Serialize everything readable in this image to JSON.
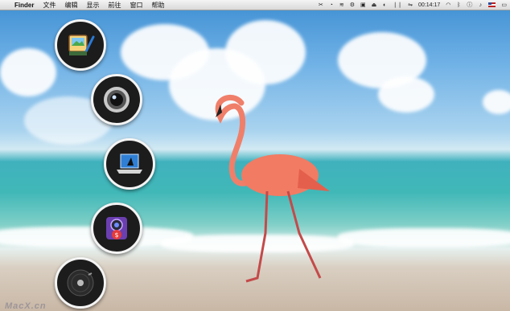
{
  "menubar": {
    "app_name": "Finder",
    "menus": [
      "文件",
      "编辑",
      "显示",
      "前往",
      "窗口",
      "帮助"
    ],
    "status": {
      "clock": "00:14:17",
      "clock_icon": "sync-arrows-icon"
    }
  },
  "dock": {
    "items": [
      {
        "name": "photo-editor-app-icon"
      },
      {
        "name": "camera-lens-app-icon"
      },
      {
        "name": "laptop-app-icon"
      },
      {
        "name": "dollar-money-app-icon"
      },
      {
        "name": "disc-app-icon"
      }
    ]
  },
  "watermark": "MacX.cn"
}
